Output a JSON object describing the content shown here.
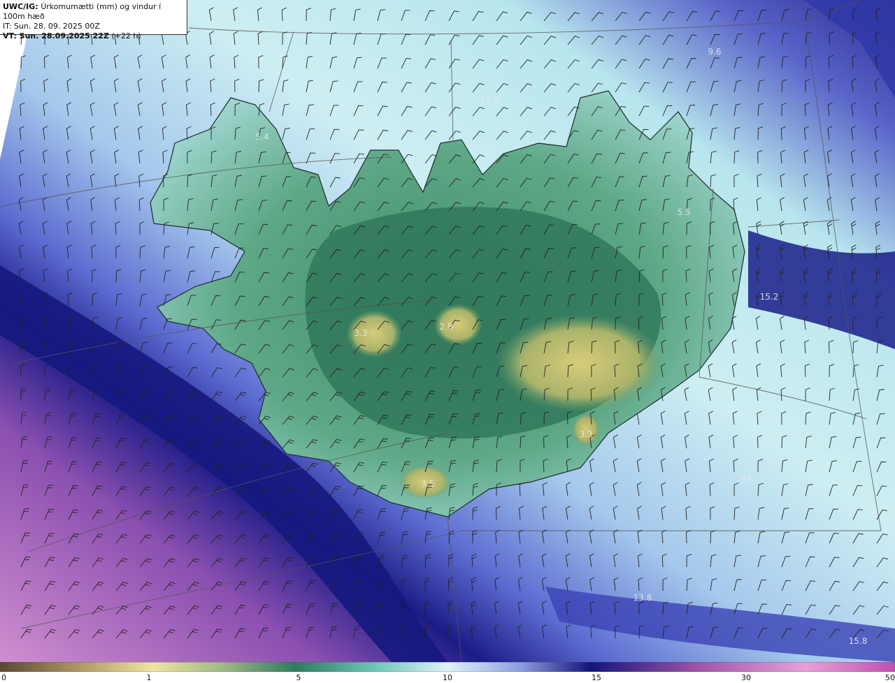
{
  "header": {
    "model": "UWC/IG:",
    "title": "Úrkomumætti (mm) og vindur í 100m hæð",
    "it_line": "IT: Sun. 28. 09. 2025 00Z",
    "vt_prefix": "VT: Sun. 28.09.2025 22Z",
    "vt_suffix": "(+22 h)"
  },
  "map_labels": [
    {
      "text": "5.4",
      "name": "label-westfjords"
    },
    {
      "text": "11.9",
      "name": "label-north-sea"
    },
    {
      "text": "5.5",
      "name": "label-east"
    },
    {
      "text": "15.2",
      "name": "label-east-sea"
    },
    {
      "text": "3.3",
      "name": "label-west-highlands"
    },
    {
      "text": "2.8",
      "name": "label-hofsjokull"
    },
    {
      "text": "3.3",
      "name": "label-oraefajokull"
    },
    {
      "text": "3.5",
      "name": "label-myrdalsjokull"
    },
    {
      "text": "13.8",
      "name": "label-south-sea"
    },
    {
      "text": "15.8",
      "name": "label-southeast-sea"
    },
    {
      "text": "9.6",
      "name": "label-northeast-sea"
    },
    {
      "text": "9.0",
      "name": "label-southeast-offshore"
    }
  ],
  "colorbar": {
    "ticks": [
      "0",
      "1",
      "5",
      "10",
      "15",
      "30",
      "50"
    ],
    "colors": [
      "#5a4830",
      "#c8b070",
      "#f0e4a0",
      "#2f7a5e",
      "#6fc7b8",
      "#dff4f8",
      "#4d59c9",
      "#14147a",
      "#a054a8",
      "#e8a0d8",
      "#c050b0"
    ]
  }
}
